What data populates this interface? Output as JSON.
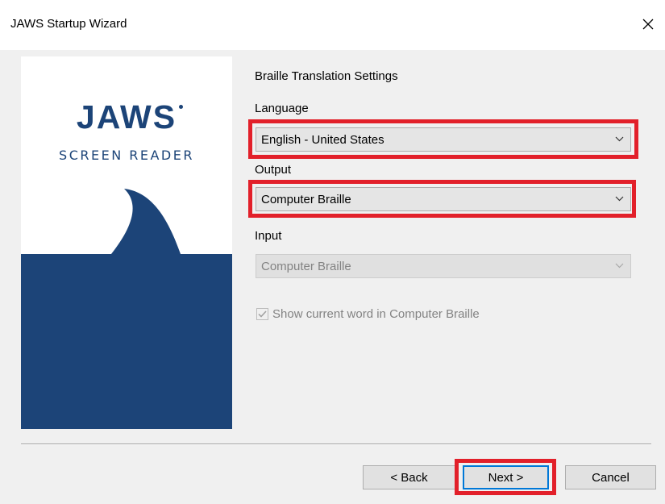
{
  "window": {
    "title": "JAWS Startup Wizard",
    "close_glyph": "✕"
  },
  "branding": {
    "logo_text": "JAWS",
    "logo_subtitle": "SCREEN READER",
    "accent_color": "#1c4478"
  },
  "page": {
    "section_title": "Braille Translation Settings"
  },
  "fields": {
    "language": {
      "label": "Language",
      "value": "English - United States",
      "highlighted": true
    },
    "output": {
      "label": "Output",
      "value": "Computer Braille",
      "highlighted": true
    },
    "input": {
      "label": "Input",
      "value": "Computer Braille",
      "enabled": false
    }
  },
  "checkbox": {
    "label": "Show current word in Computer Braille",
    "checked": true,
    "enabled": false
  },
  "buttons": {
    "back": "< Back",
    "next": "Next >",
    "cancel": "Cancel"
  },
  "highlight_color": "#e2202a"
}
